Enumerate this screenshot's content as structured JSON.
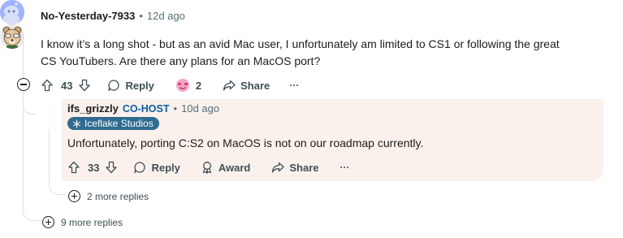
{
  "comment": {
    "username": "No-Yesterday-7933",
    "separator": "•",
    "time_ago": "12d ago",
    "text": "I know it’s a long shot - but as an avid Mac user, I unfortunately am limited to CS1 or following the great CS YouTubers. Are there any plans for an MacOS port?",
    "upvotes": "43",
    "reply_label": "Reply",
    "award_count": "2",
    "share_label": "Share",
    "overflow_label": "···",
    "more_replies_label": "9 more replies"
  },
  "reply": {
    "username": "ifs_grizzly",
    "role_tag": "CO-HOST",
    "separator": "•",
    "time_ago": "10d ago",
    "flair": "Iceflake Studios",
    "text": "Unfortunately, porting C:S2 on MacOS is not on our roadmap currently.",
    "upvotes": "33",
    "reply_label": "Reply",
    "award_label": "Award",
    "share_label": "Share",
    "overflow_label": "···",
    "more_replies_label": "2 more replies"
  },
  "colors": {
    "reply_background": "#fbf1ec",
    "cohost_tag": "#0b5fa3",
    "flair_background": "#2f6b8f",
    "thread_line": "#dbe0e3"
  }
}
